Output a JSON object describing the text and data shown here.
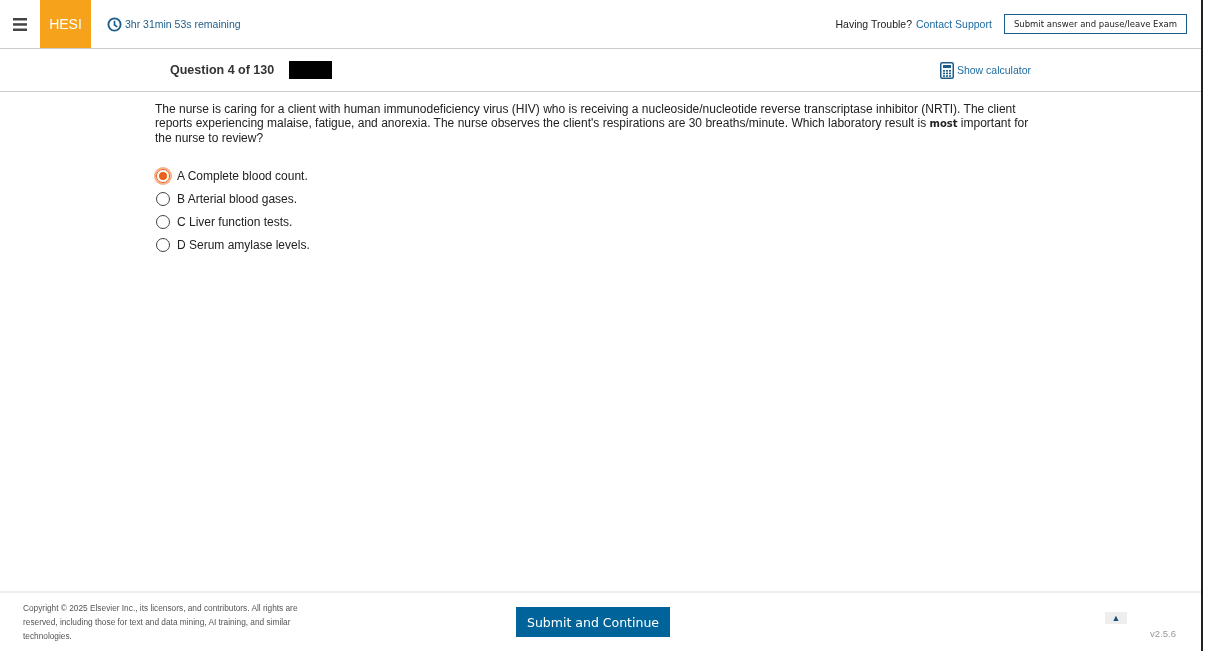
{
  "header": {
    "logo": "HESI",
    "timer": "3hr 31min 53s remaining",
    "help_text": "Having Trouble?",
    "help_link": "Contact Support",
    "exit_button": "Submit answer and pause/leave Exam"
  },
  "question_bar": {
    "title": "Question 4 of 130",
    "calculator_link": "Show calculator"
  },
  "question": {
    "text": "The nurse is caring for a client with human immunodeficiency virus (HIV) who is receiving a nucleoside/nucleotide reverse transcriptase inhibitor (NRTI). The client reports experiencing malaise, fatigue, and anorexia. The nurse observes the client's respirations are 30 breaths/minute. Which laboratory result is **most** important for the nurse to review?",
    "options": [
      {
        "label": "A Complete blood count.",
        "selected": true
      },
      {
        "label": "B Arterial blood gases.",
        "selected": false
      },
      {
        "label": "C Liver function tests.",
        "selected": false
      },
      {
        "label": "D Serum amylase levels.",
        "selected": false
      }
    ]
  },
  "footer": {
    "copyright": "Copyright © 2025 Elsevier Inc., its licensors, and contributors. All rights are reserved, including those for text and data mining, AI training, and similar technologies.",
    "submit_button": "Submit and Continue",
    "scroll_top": "▲",
    "version": "v2.5.6"
  }
}
